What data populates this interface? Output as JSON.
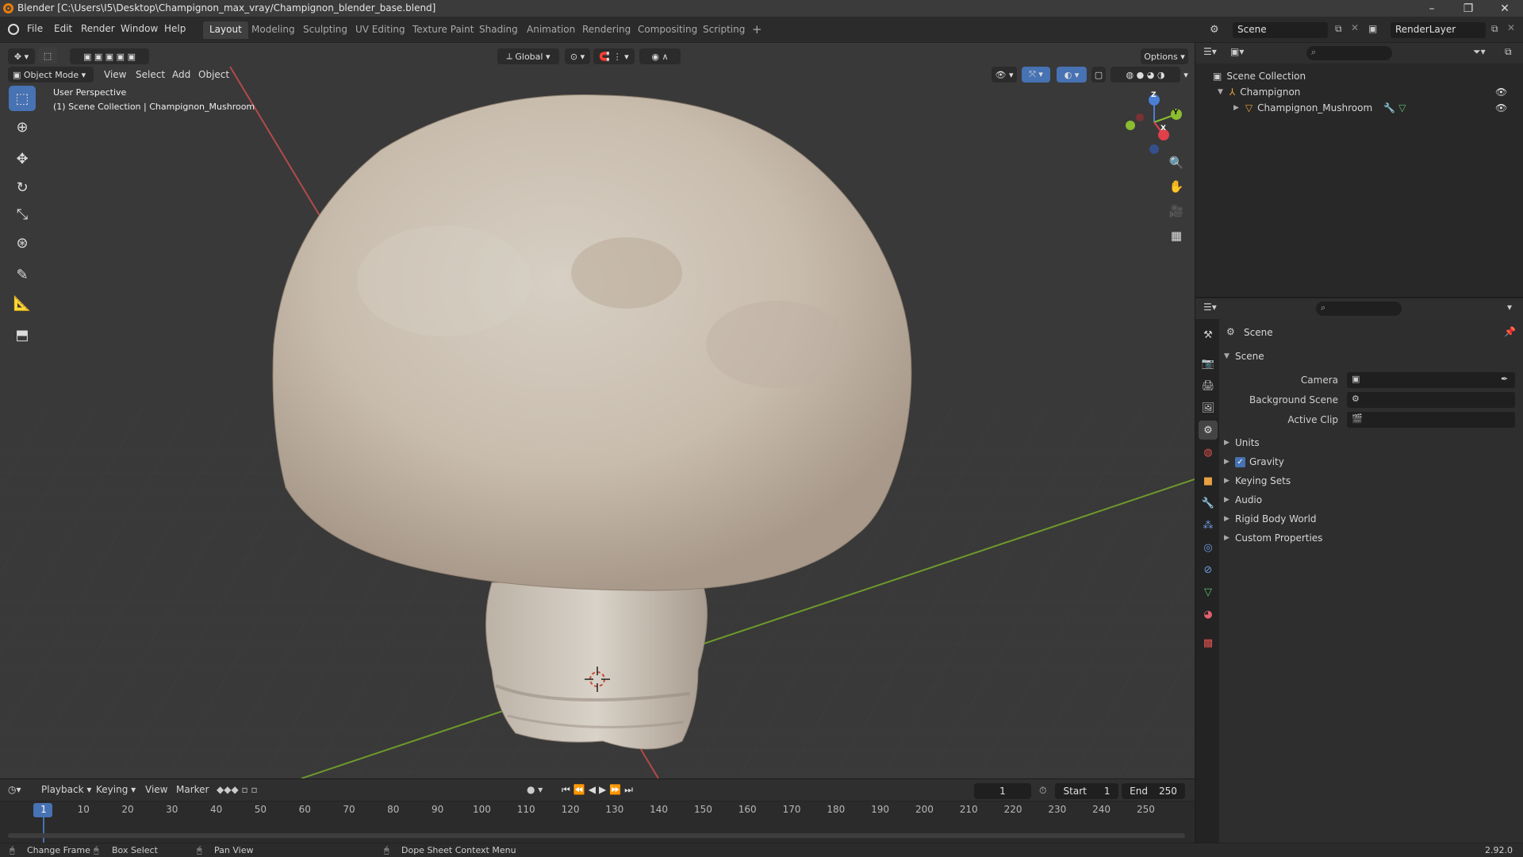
{
  "window": {
    "title": "Blender [C:\\Users\\I5\\Desktop\\Champignon_max_vray/Champignon_blender_base.blend]",
    "minimize": "–",
    "maximize": "❐",
    "close": "✕"
  },
  "menu": {
    "items": [
      "File",
      "Edit",
      "Render",
      "Window",
      "Help"
    ]
  },
  "workspaces": {
    "tabs": [
      "Layout",
      "Modeling",
      "Sculpting",
      "UV Editing",
      "Texture Paint",
      "Shading",
      "Animation",
      "Rendering",
      "Compositing",
      "Scripting"
    ],
    "active": "Layout",
    "add": "+"
  },
  "scene_selector": {
    "value": "Scene"
  },
  "view_layer_selector": {
    "value": "RenderLayer"
  },
  "viewport": {
    "mode": "Object Mode",
    "menu": [
      "View",
      "Select",
      "Add",
      "Object"
    ],
    "transform_orientation": "Global",
    "options_label": "Options",
    "overlay_line1": "User Perspective",
    "overlay_line2": "(1) Scene Collection | Champignon_Mushroom",
    "gizmo": {
      "x": "X",
      "y": "Y",
      "z": "Z"
    },
    "colors": {
      "x_axis": "#b34a4a",
      "y_axis": "#6e9a2b",
      "background": "#393939"
    }
  },
  "outliner": {
    "root": "Scene Collection",
    "collection": "Champignon",
    "object": "Champignon_Mushroom"
  },
  "properties": {
    "context": "Scene",
    "panel_title": "Scene",
    "fields": {
      "camera_label": "Camera",
      "background_scene_label": "Background Scene",
      "active_clip_label": "Active Clip"
    },
    "subpanels": [
      "Units",
      "Gravity",
      "Keying Sets",
      "Audio",
      "Rigid Body World",
      "Custom Properties"
    ],
    "gravity_checked": true
  },
  "timeline": {
    "menu": [
      "Playback",
      "Keying",
      "View",
      "Marker"
    ],
    "current_frame": "1",
    "start_label": "Start",
    "start_value": "1",
    "end_label": "End",
    "end_value": "250",
    "ticks": [
      "1",
      "10",
      "20",
      "30",
      "40",
      "50",
      "60",
      "70",
      "80",
      "90",
      "100",
      "110",
      "120",
      "130",
      "140",
      "150",
      "160",
      "170",
      "180",
      "190",
      "200",
      "210",
      "220",
      "230",
      "240",
      "250"
    ]
  },
  "statusbar": {
    "change_frame": "Change Frame",
    "box_select": "Box Select",
    "pan_view": "Pan View",
    "context_menu": "Dope Sheet Context Menu",
    "version": "2.92.0"
  }
}
